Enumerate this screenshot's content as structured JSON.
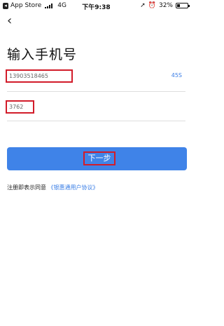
{
  "status_bar": {
    "back_app": "App Store",
    "network": "4G",
    "time": "下午9:38",
    "battery_percent": "32%",
    "battery_level": 0.32
  },
  "nav": {
    "back_glyph": "‹"
  },
  "page": {
    "title": "输入手机号"
  },
  "phone": {
    "value": "13903518465",
    "countdown": "45S"
  },
  "code": {
    "value": "3762"
  },
  "actions": {
    "next_label": "下一步"
  },
  "agreement": {
    "prefix": "注册即表示同意",
    "link": "《银惠通用户协议》"
  },
  "colors": {
    "accent": "#3f83e8",
    "link": "#3a7ee6",
    "highlight": "#d21c2a"
  }
}
